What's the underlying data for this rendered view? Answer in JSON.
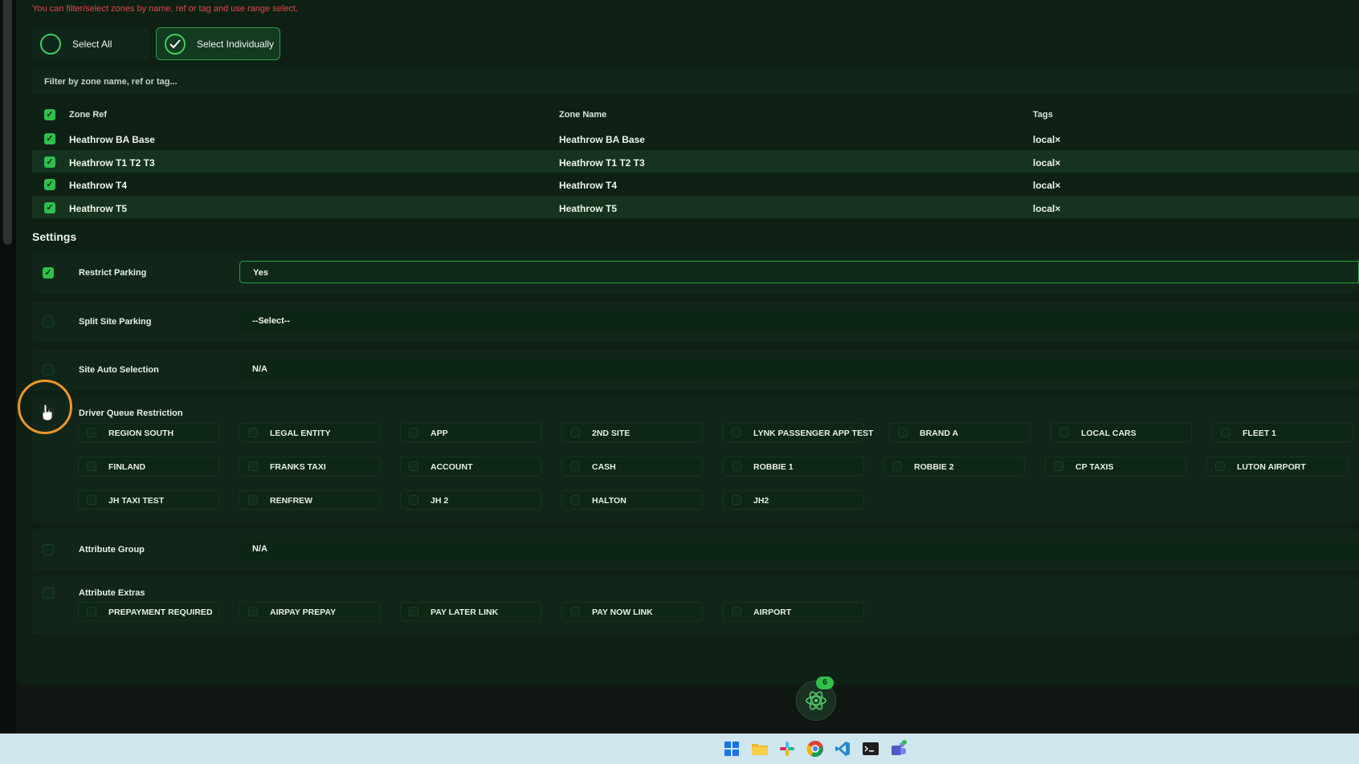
{
  "hint": "You can filter/select zones by name, ref or tag and use range select.",
  "select_all_label": "Select All",
  "select_individually_label": "Select Individually",
  "filter_placeholder": "Filter by zone name, ref or tag...",
  "zones": {
    "headers": [
      "Zone Ref",
      "Zone Name",
      "Tags"
    ],
    "rows": [
      {
        "ref": "Heathrow BA Base",
        "name": "Heathrow BA Base",
        "tag": "local×"
      },
      {
        "ref": "Heathrow T1 T2 T3",
        "name": "Heathrow T1 T2 T3",
        "tag": "local×"
      },
      {
        "ref": "Heathrow T4",
        "name": "Heathrow T4",
        "tag": "local×"
      },
      {
        "ref": "Heathrow T5",
        "name": "Heathrow T5",
        "tag": "local×"
      }
    ]
  },
  "settings": {
    "title": "Settings",
    "restrict_parking": {
      "label": "Restrict Parking",
      "value": "Yes"
    },
    "split_site_parking": {
      "label": "Split Site Parking",
      "value": "--Select--"
    },
    "site_auto_selection": {
      "label": "Site Auto Selection",
      "value": "N/A"
    },
    "driver_queue": {
      "label": "Driver Queue Restriction",
      "options": [
        "REGION SOUTH",
        "LEGAL ENTITY",
        "APP",
        "2ND SITE",
        "LYNK PASSENGER APP TEST",
        "BRAND A",
        "LOCAL CARS",
        "FLEET 1",
        "FINLAND",
        "FRANKS TAXI",
        "ACCOUNT",
        "CASH",
        "ROBBIE 1",
        "ROBBIE 2",
        "CP TAXIS",
        "LUTON AIRPORT",
        "JH TAXI TEST",
        "RENFREW",
        "JH 2",
        "HALTON",
        "JH2"
      ]
    },
    "attribute_group": {
      "label": "Attribute Group",
      "value": "N/A"
    },
    "attribute_extras": {
      "label": "Attribute Extras",
      "options": [
        "PREPAYMENT REQUIRED",
        "AIRPAY PREPAY",
        "PAY LATER LINK",
        "PAY NOW LINK",
        "AIRPORT"
      ]
    }
  },
  "fab_badge": "6",
  "colors": {
    "accent": "#2fc04c",
    "panel": "#0e2014",
    "cursor_ring": "#f0962a",
    "error": "#e04848"
  },
  "taskbar_icons": [
    "windows-start-icon",
    "file-explorer-icon",
    "slack-icon",
    "chrome-icon",
    "vscode-icon",
    "terminal-icon",
    "teams-icon"
  ]
}
